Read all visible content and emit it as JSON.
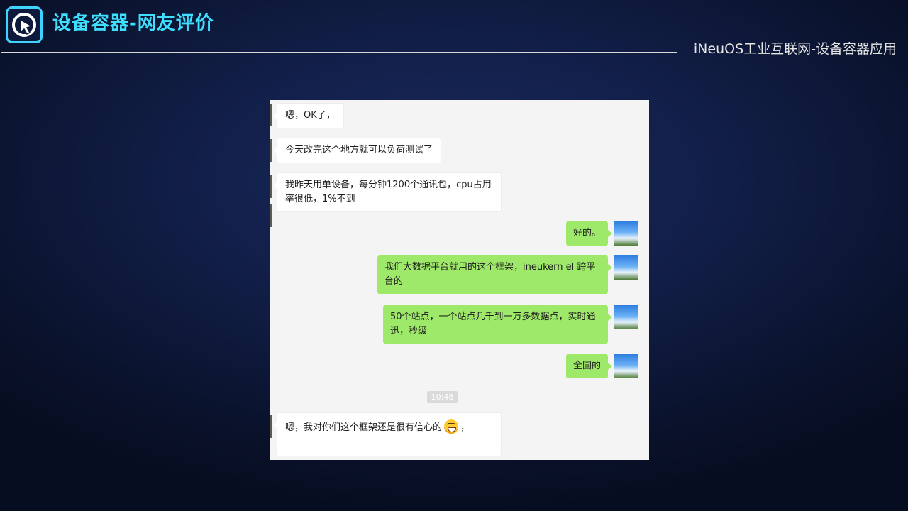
{
  "header": {
    "title": "设备容器-网友评价",
    "subtitle": "iNeuOS工业互联网-设备容器应用",
    "logo_icon": "cursor-pointer-icon"
  },
  "chat": {
    "messages": [
      {
        "side": "incoming",
        "text": "嗯，OK了，"
      },
      {
        "side": "incoming",
        "text": "今天改完这个地方就可以负荷测试了"
      },
      {
        "side": "incoming",
        "text": "我昨天用单设备，每分钟1200个通讯包，cpu占用率很低，1%不到"
      },
      {
        "side": "outgoing",
        "text": "好的。"
      },
      {
        "side": "outgoing",
        "text": "我们大数据平台就用的这个框架，ineukern el 跨平台的"
      },
      {
        "side": "outgoing",
        "text": "50个站点，一个站点几千到一万多数据点，实时通迅，秒级"
      },
      {
        "side": "outgoing",
        "text": "全国的"
      },
      {
        "side": "incoming",
        "text": "嗯，我对你们这个框架还是很有信心的",
        "suffix": "，",
        "emoji": "grinning-face-icon"
      }
    ],
    "timestamp": "10:48"
  },
  "colors": {
    "title": "#3fe0ff",
    "outgoing_bubble": "#9fe96a",
    "incoming_bubble": "#ffffff",
    "panel": "#f4f4f4"
  }
}
